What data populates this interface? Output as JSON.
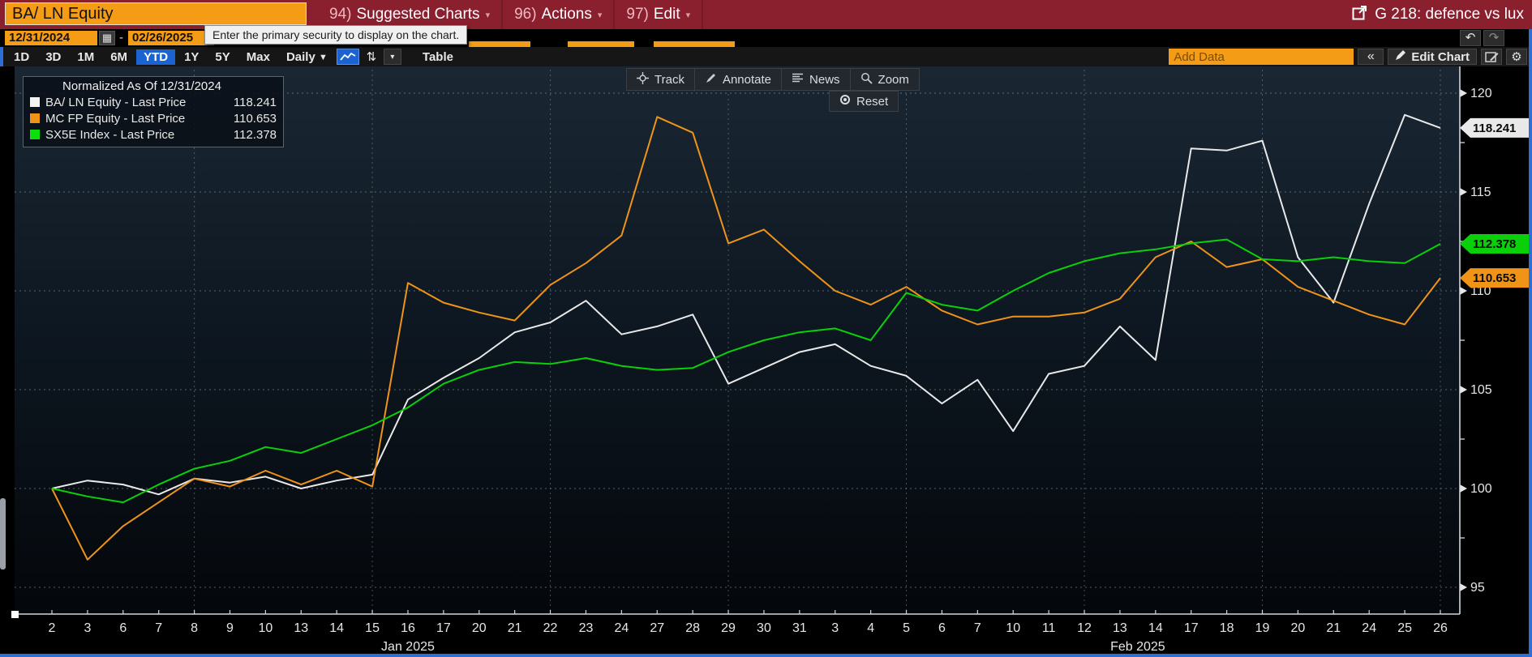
{
  "window": {
    "security": "BA/ LN Equity",
    "function_label": "G 218: defence vs lux"
  },
  "menu_bar": {
    "items": [
      {
        "num": "94)",
        "label": "Suggested Charts",
        "caret": "▾"
      },
      {
        "num": "96)",
        "label": "Actions",
        "caret": "▾"
      },
      {
        "num": "97)",
        "label": "Edit",
        "caret": "▾"
      }
    ]
  },
  "date_row": {
    "start_date": "12/31/2024",
    "separator": "-",
    "end_date": "02/26/2025",
    "calendar_icon": "▦",
    "tooltip": "Enter the primary security to display on the chart.",
    "undo_icon": "↶",
    "redo_icon": "↷"
  },
  "toolbar": {
    "ranges": [
      "1D",
      "3D",
      "1M",
      "6M",
      "YTD",
      "1Y",
      "5Y",
      "Max"
    ],
    "active_range": "YTD",
    "frequency": "Daily",
    "frequency_caret": "▼",
    "compare_icon": "⇅",
    "mini_caret": "▾",
    "table_label": "Table",
    "add_data_placeholder": "Add Data",
    "collapse_label": "«",
    "edit_chart_label": "Edit Chart",
    "gear_icon": "⚙"
  },
  "chart_overlay": {
    "buttons": [
      {
        "label": "Track",
        "icon": "track-crosshair-icon"
      },
      {
        "label": "Annotate",
        "icon": "annotate-pencil-icon"
      },
      {
        "label": "News",
        "icon": "news-lines-icon"
      },
      {
        "label": "Zoom",
        "icon": "zoom-magnifier-icon"
      }
    ],
    "reset_label": "Reset",
    "reset_icon": "reset-target-icon"
  },
  "legend": {
    "title": "Normalized As Of 12/31/2024",
    "entries": [
      {
        "label": "BA/ LN Equity - Last Price",
        "value": "118.241",
        "color": "#f2f2f2"
      },
      {
        "label": "MC FP Equity - Last Price",
        "value": "110.653",
        "color": "#ef9417"
      },
      {
        "label": "SX5E Index - Last Price",
        "value": "112.378",
        "color": "#0ae00a"
      }
    ]
  },
  "chart_data": {
    "type": "line",
    "title": "Normalized As Of 12/31/2024",
    "normalize_date": "12/31/2024",
    "grid": "dotted",
    "legend_position": "top-left",
    "ylim": [
      93.5,
      121
    ],
    "yticks": [
      95,
      100,
      105,
      110,
      115,
      120
    ],
    "minor_yticks": [
      97.5,
      102.5,
      107.5,
      112.5,
      117.5
    ],
    "categories": [
      "2",
      "3",
      "6",
      "7",
      "8",
      "9",
      "10",
      "13",
      "14",
      "15",
      "16",
      "17",
      "20",
      "21",
      "22",
      "23",
      "24",
      "27",
      "28",
      "29",
      "30",
      "31",
      "3",
      "4",
      "5",
      "6",
      "7",
      "10",
      "11",
      "12",
      "13",
      "14",
      "17",
      "18",
      "19",
      "20",
      "21",
      "24",
      "25",
      "26"
    ],
    "month_labels": [
      {
        "label": "Jan 2025",
        "center_index": 10.0
      },
      {
        "label": "Feb 2025",
        "center_index": 30.5
      }
    ],
    "week_grid_indices": [
      4,
      9,
      14,
      19,
      24,
      29,
      34,
      39
    ],
    "series": [
      {
        "name": "BA/ LN Equity - Last Price",
        "color": "#e9e9e9",
        "last_label": "118.241",
        "values": [
          100.0,
          100.4,
          100.2,
          99.7,
          100.5,
          100.3,
          100.6,
          100.0,
          100.4,
          100.7,
          104.5,
          105.6,
          106.6,
          107.9,
          108.4,
          109.5,
          107.8,
          108.2,
          108.8,
          105.3,
          106.1,
          106.9,
          107.3,
          106.2,
          105.7,
          104.3,
          105.5,
          102.9,
          105.8,
          106.2,
          108.2,
          106.5,
          117.2,
          117.1,
          117.6,
          111.7,
          109.4,
          114.4,
          118.9,
          118.241
        ]
      },
      {
        "name": "MC FP Equity - Last Price",
        "color": "#ef9417",
        "last_label": "110.653",
        "values": [
          100.0,
          96.4,
          98.1,
          99.3,
          100.5,
          100.1,
          100.9,
          100.2,
          100.9,
          100.1,
          110.4,
          109.4,
          108.9,
          108.5,
          110.3,
          111.4,
          112.8,
          118.8,
          118.0,
          112.4,
          113.1,
          111.5,
          110.0,
          109.3,
          110.2,
          109.0,
          108.3,
          108.7,
          108.7,
          108.9,
          109.6,
          111.7,
          112.5,
          111.2,
          111.6,
          110.2,
          109.5,
          108.8,
          108.3,
          110.653
        ]
      },
      {
        "name": "SX5E Index - Last Price",
        "color": "#0ad00a",
        "last_label": "112.378",
        "values": [
          100.0,
          99.6,
          99.3,
          100.2,
          101.0,
          101.4,
          102.1,
          101.8,
          102.5,
          103.2,
          104.1,
          105.3,
          106.0,
          106.4,
          106.3,
          106.6,
          106.2,
          106.0,
          106.1,
          106.9,
          107.5,
          107.9,
          108.1,
          107.5,
          109.9,
          109.3,
          109.0,
          110.0,
          110.9,
          111.5,
          111.9,
          112.1,
          112.4,
          112.6,
          111.6,
          111.5,
          111.7,
          111.5,
          111.4,
          112.378
        ]
      }
    ]
  }
}
